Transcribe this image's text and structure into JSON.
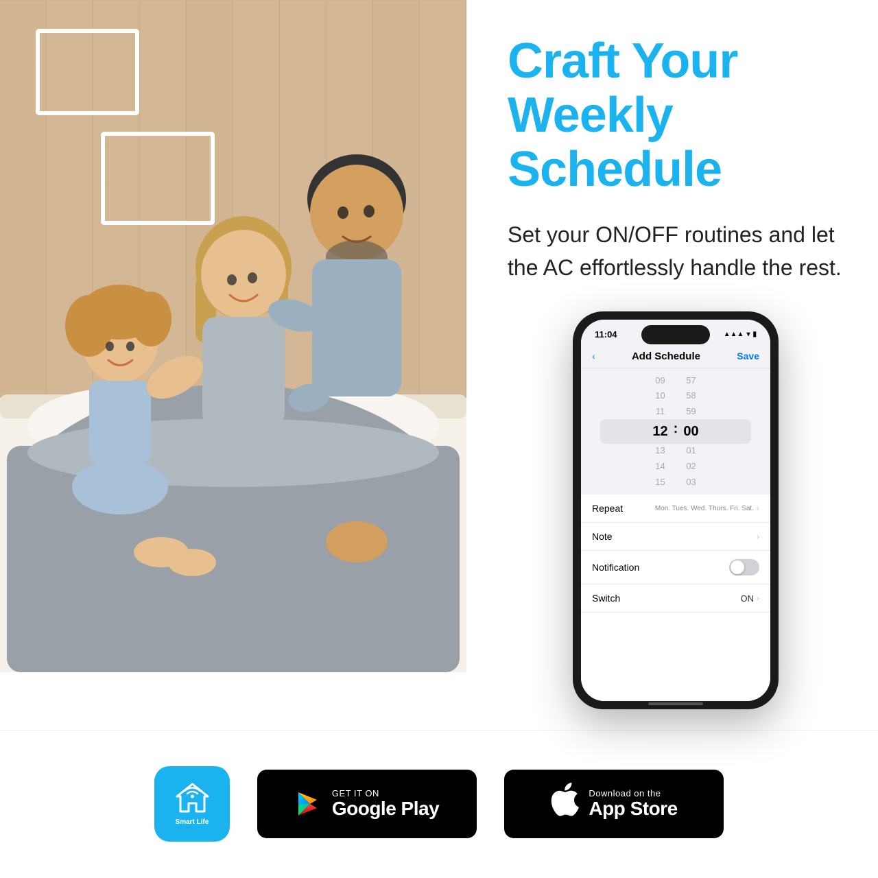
{
  "headline": {
    "line1": "Craft Your",
    "line2": "Weekly",
    "line3": "Schedule"
  },
  "subtext": "Set your ON/OFF routines and let the AC effortlessly handle the rest.",
  "phone": {
    "status_time": "11:04",
    "nav_back": "‹",
    "nav_title": "Add Schedule",
    "nav_save": "Save",
    "time_picker": {
      "hours": [
        "09",
        "10",
        "11",
        "12",
        "13",
        "14",
        "15"
      ],
      "minutes": [
        "57",
        "58",
        "59",
        "00",
        "01",
        "02",
        "03"
      ],
      "selected_hour": "12",
      "selected_minute": "00"
    },
    "settings": [
      {
        "label": "Repeat",
        "value": "Mon. Tues. Wed. Thurs. Fri. Sat.",
        "type": "arrow"
      },
      {
        "label": "Note",
        "value": "",
        "type": "arrow"
      },
      {
        "label": "Notification",
        "value": "",
        "type": "toggle"
      },
      {
        "label": "Switch",
        "value": "ON",
        "type": "arrow"
      }
    ]
  },
  "bottom": {
    "smart_life_label": "Smart Life",
    "google_play_subtitle": "GET IT ON",
    "google_play_title": "Google Play",
    "app_store_subtitle": "Download on the",
    "app_store_title": "App Store"
  }
}
